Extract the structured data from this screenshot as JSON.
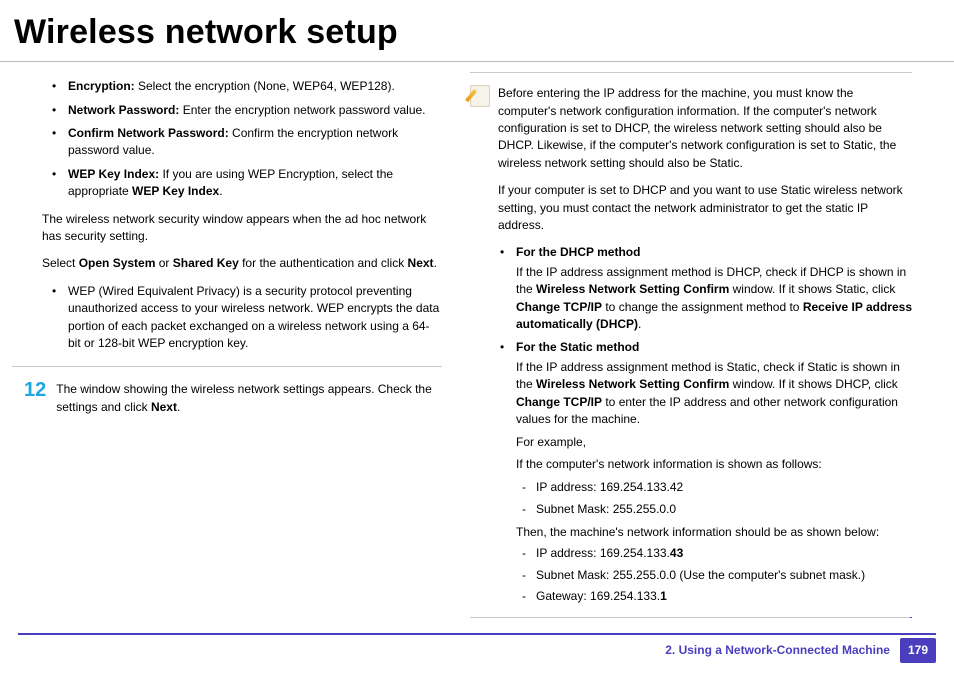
{
  "title": "Wireless network setup",
  "left": {
    "bullets": [
      {
        "label": "Encryption:",
        "text": " Select the encryption (None, WEP64, WEP128)."
      },
      {
        "label": "Network Password:",
        "text": " Enter the encryption network password value."
      },
      {
        "label": "Confirm Network Password:",
        "text": " Confirm the encryption network password value."
      },
      {
        "label": "WEP Key Index:",
        "text_before": " If you are using WEP Encryption, select the appropriate ",
        "bold_tail": "WEP Key Index",
        "tail": "."
      }
    ],
    "para_after_bullets": "The wireless network security window appears when the ad hoc network has security setting.",
    "auth_line": {
      "pre": "Select ",
      "b1": "Open System",
      "mid": " or ",
      "b2": "Shared Key",
      "post1": " for the authentication and click ",
      "b3": "Next",
      "post2": "."
    },
    "wep_note": "WEP (Wired Equivalent Privacy) is a security protocol preventing unauthorized access to your wireless network. WEP encrypts the data portion of each packet exchanged on a wireless network using a 64-bit or 128-bit WEP encryption key.",
    "step12": {
      "num": "12",
      "text_pre": "The window showing the wireless network settings appears. Check the settings and click ",
      "b": "Next",
      "tail": "."
    }
  },
  "right": {
    "note1": "Before entering the IP address for the machine, you must know the computer's network configuration information. If the computer's network configuration is set to DHCP, the wireless network setting should also be DHCP. Likewise, if the computer's network configuration is set to Static, the wireless network setting should also be Static.",
    "note2": "If your computer is set to DHCP and you want to use Static wireless network setting, you must contact the network administrator to get the static IP address.",
    "dhcp": {
      "heading": "For the DHCP method",
      "pre": "If the IP address assignment method is DHCP, check if DHCP is shown in the ",
      "b1": "Wireless Network Setting Confirm",
      "mid1": " window. If it shows Static, click ",
      "b2": "Change TCP/IP",
      "mid2": " to change the assignment method to ",
      "b3": "Receive IP address automatically (DHCP)",
      "tail": "."
    },
    "static": {
      "heading": "For the Static method",
      "pre": "If the IP address assignment method is Static, check if Static is shown in the ",
      "b1": "Wireless Network Setting Confirm",
      "mid1": " window. If it shows DHCP, click ",
      "b2": "Change TCP/IP",
      "mid2": " to enter the IP address and other network configuration values for the machine.",
      "example_label": "For example,",
      "example_intro": "If the computer's network information is shown as follows:",
      "comp_ip": "IP address: 169.254.133.42",
      "comp_mask": "Subnet Mask: 255.255.0.0",
      "then_line": "Then, the machine's network information should be as shown below:",
      "mach_ip_pre": "IP address: 169.254.133.",
      "mach_ip_bold": "43",
      "mach_mask": "Subnet Mask: 255.255.0.0 (Use the computer's subnet mask.)",
      "mach_gw_pre": "Gateway: 169.254.133.",
      "mach_gw_bold": "1"
    }
  },
  "footer": {
    "chapter": "2.  Using a Network-Connected Machine",
    "page": "179"
  }
}
